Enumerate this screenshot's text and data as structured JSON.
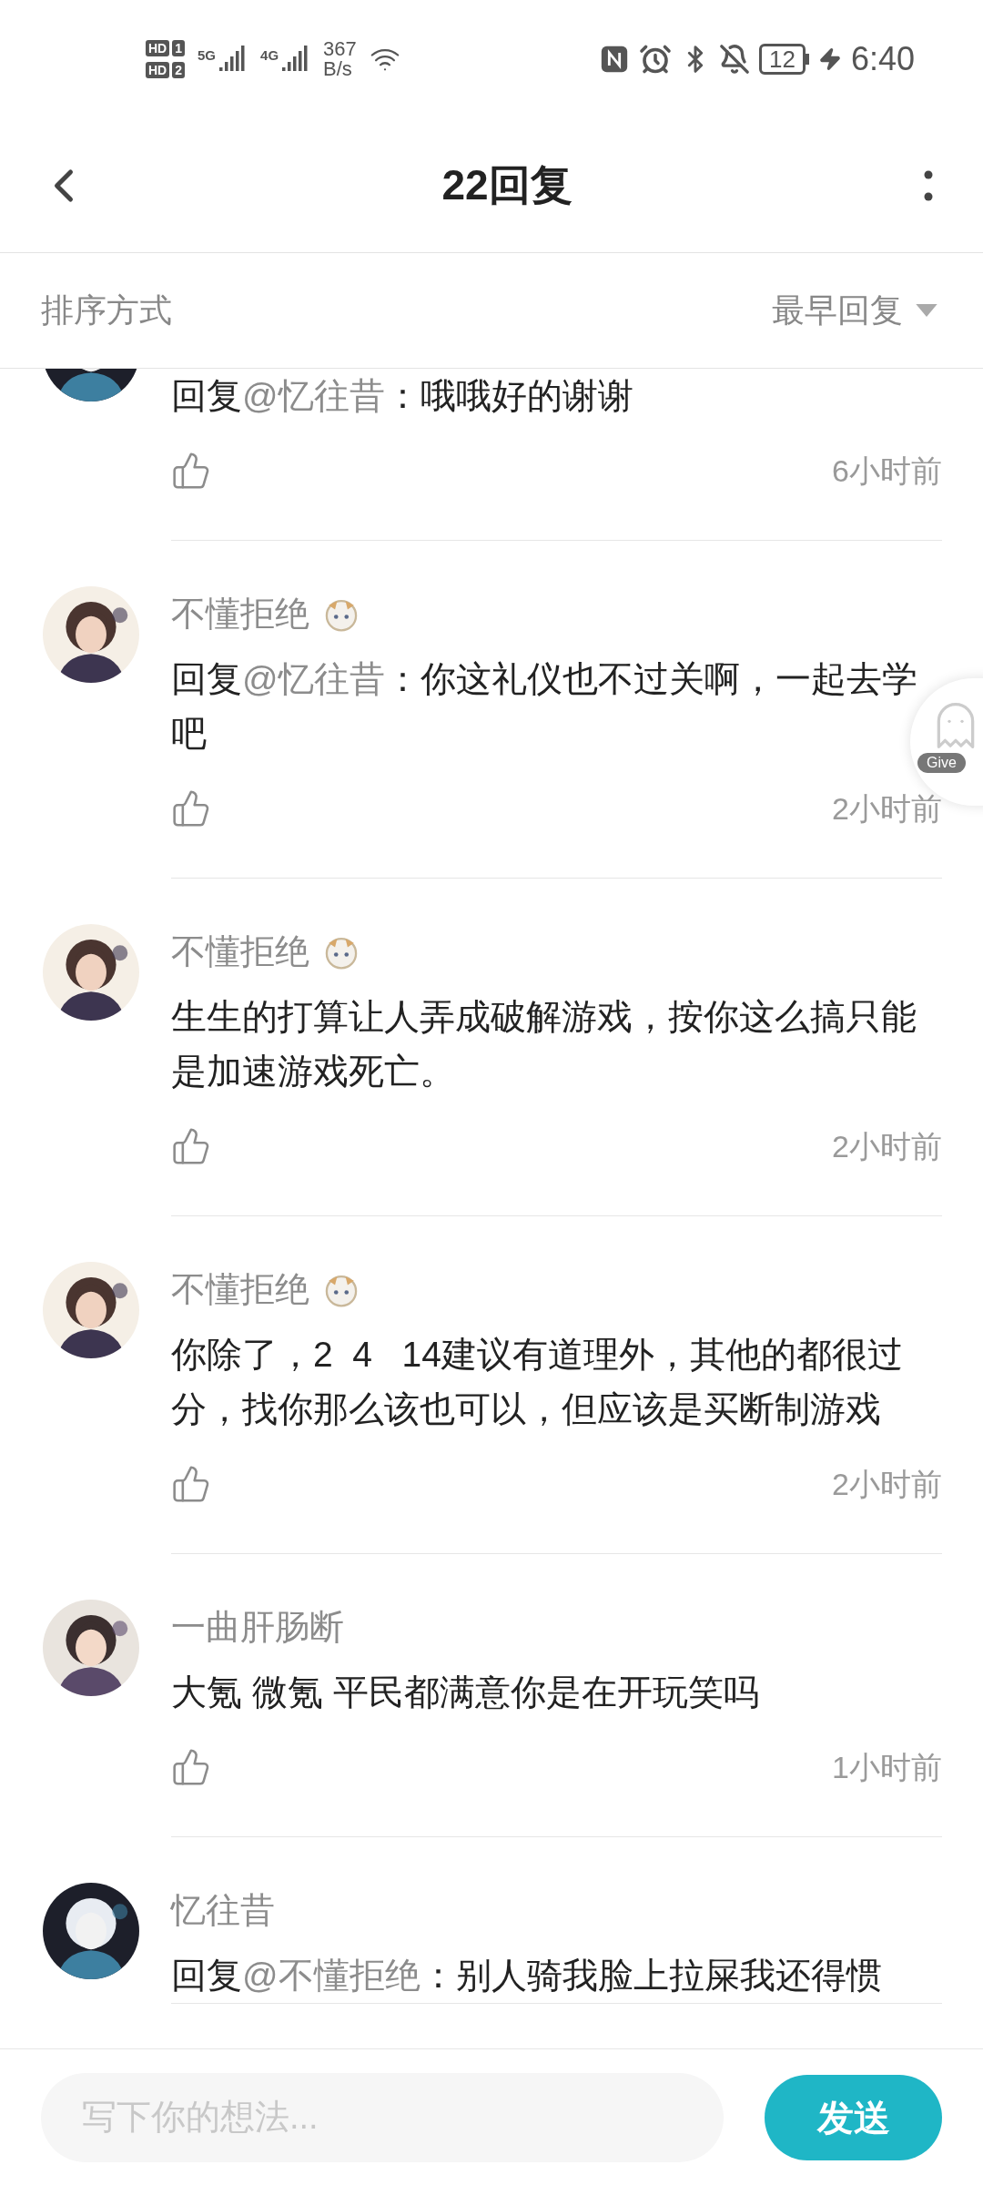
{
  "status_bar": {
    "sims": [
      {
        "label": "HD",
        "slot": "1"
      },
      {
        "label": "HD",
        "slot": "2"
      }
    ],
    "networks": [
      "5G",
      "4G"
    ],
    "speed": [
      "367",
      "B/s"
    ],
    "battery": "12",
    "time": "6:40"
  },
  "header": {
    "title": "22回复"
  },
  "sort": {
    "label": "排序方式",
    "value": "最早回复"
  },
  "comments": [
    {
      "prefix": "回复",
      "mention": "@忆往昔",
      "text": "：哦哦好的谢谢",
      "time": "6小时前"
    },
    {
      "name": "不懂拒绝",
      "sticker": true,
      "prefix": "回复",
      "mention": "@忆往昔",
      "text": "：你这礼仪也不过关啊，一起去学吧",
      "time": "2小时前"
    },
    {
      "name": "不懂拒绝",
      "sticker": true,
      "text": "生生的打算让人弄成破解游戏，按你这么搞只能是加速游戏死亡。",
      "time": "2小时前"
    },
    {
      "name": "不懂拒绝",
      "sticker": true,
      "text": "你除了，2  4   14建议有道理外，其他的都很过分，找你那么该也可以，但应该是买断制游戏",
      "time": "2小时前"
    },
    {
      "name": "一曲肝肠断",
      "sticker": false,
      "text": "大氪 微氪 平民都满意你是在开玩笑吗",
      "time": "1小时前"
    },
    {
      "name": "忆往昔",
      "sticker": false,
      "prefix": "回复",
      "mention": "@不懂拒绝",
      "text": "：别人骑我脸上拉屎我还得惯"
    }
  ],
  "float_badge": {
    "label": "Give"
  },
  "composer": {
    "placeholder": "写下你的想法...",
    "send": "发送"
  }
}
